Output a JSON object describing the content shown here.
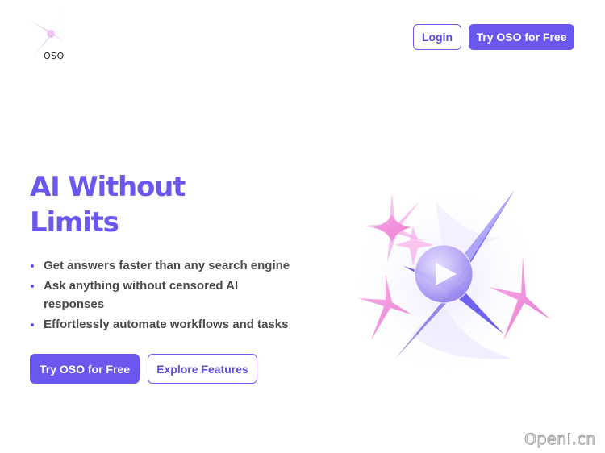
{
  "brand": {
    "name": "OSO"
  },
  "nav": {
    "login_label": "Login",
    "cta_label": "Try OSO for Free"
  },
  "hero": {
    "title_line1": "AI Without",
    "title_line2": "Limits",
    "features": [
      "Get answers faster than any search engine",
      "Ask anything without censored AI responses",
      "Effortlessly automate workflows and tasks"
    ],
    "cta_label": "Try OSO for Free",
    "explore_label": "Explore Features"
  },
  "watermark": "OpenI.cn",
  "colors": {
    "accent": "#6a57ee",
    "accent_light": "#9b8ff5",
    "pink": "#f07fd8",
    "text": "#4a4a4a"
  },
  "icons": {
    "logo": "sparkle-logo-icon",
    "hero": "sparkle-cluster-play-icon"
  }
}
